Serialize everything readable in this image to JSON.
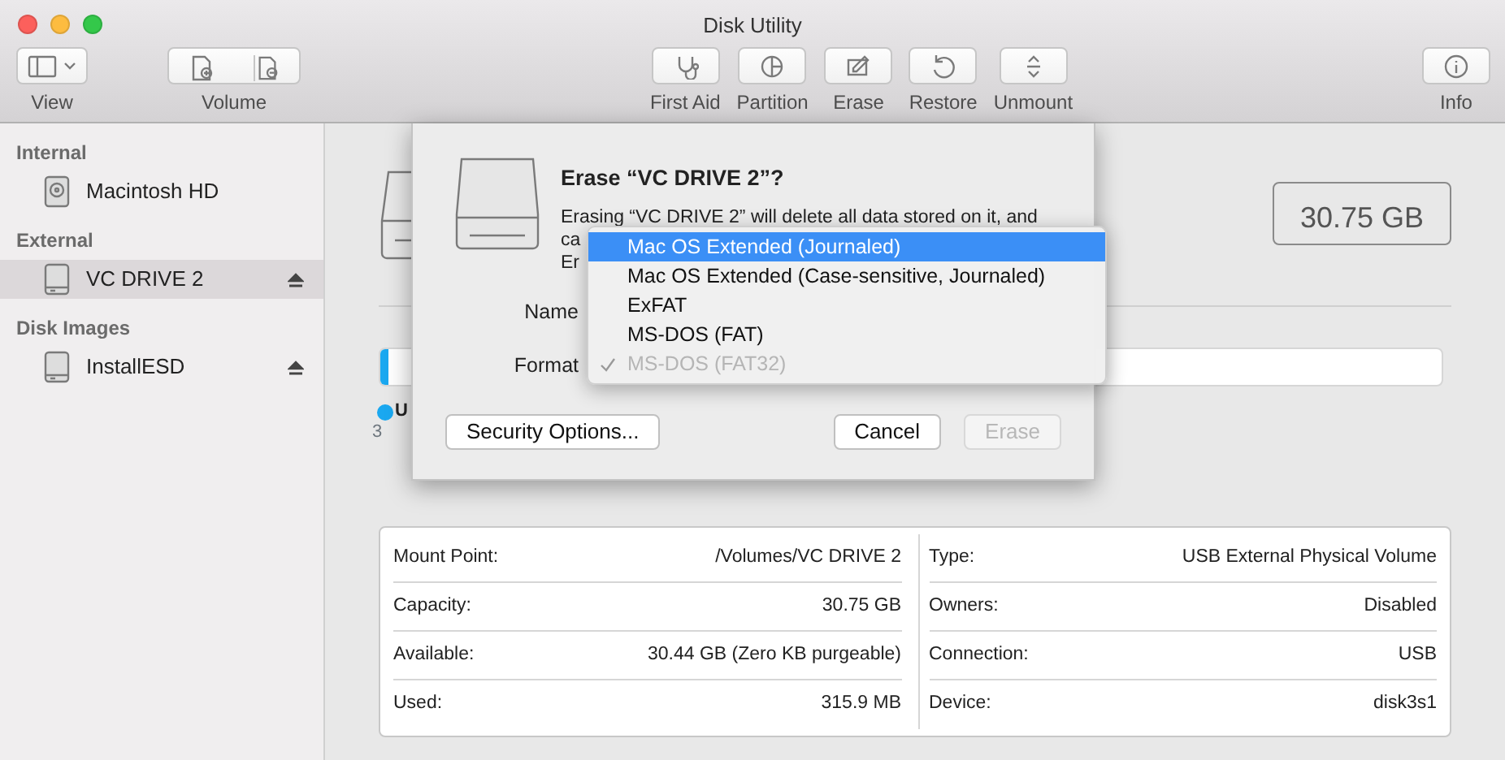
{
  "window": {
    "title": "Disk Utility"
  },
  "toolbar": [
    {
      "label": "View",
      "kind": "view"
    },
    {
      "label": "Volume",
      "kind": "volume"
    },
    {
      "label": "First Aid",
      "kind": "firstaid"
    },
    {
      "label": "Partition",
      "kind": "partition"
    },
    {
      "label": "Erase",
      "kind": "erase"
    },
    {
      "label": "Restore",
      "kind": "restore"
    },
    {
      "label": "Unmount",
      "kind": "unmount"
    },
    {
      "label": "Info",
      "kind": "info"
    }
  ],
  "sidebar": [
    {
      "title": "Internal",
      "items": [
        {
          "name": "Macintosh HD",
          "kind": "internal",
          "selected": false,
          "ejectable": false
        }
      ]
    },
    {
      "title": "External",
      "items": [
        {
          "name": "VC DRIVE 2",
          "kind": "external",
          "selected": true,
          "ejectable": true
        }
      ]
    },
    {
      "title": "Disk Images",
      "items": [
        {
          "name": "InstallESD",
          "kind": "external",
          "selected": false,
          "ejectable": true
        }
      ]
    }
  ],
  "main": {
    "size": "30.75 GB",
    "usage": {
      "level": 0.008,
      "legend_label": "U",
      "legend_value": "3"
    },
    "info_left": [
      {
        "label": "Mount Point:",
        "value": "/Volumes/VC DRIVE 2"
      },
      {
        "label": "Capacity:",
        "value": "30.75 GB"
      },
      {
        "label": "Available:",
        "value": "30.44 GB (Zero KB purgeable)"
      },
      {
        "label": "Used:",
        "value": "315.9 MB"
      }
    ],
    "info_right": [
      {
        "label": "Type:",
        "value": "USB External Physical Volume"
      },
      {
        "label": "Owners:",
        "value": "Disabled"
      },
      {
        "label": "Connection:",
        "value": "USB"
      },
      {
        "label": "Device:",
        "value": "disk3s1"
      }
    ]
  },
  "dialog": {
    "title": "Erase “VC DRIVE 2”?",
    "message_lines": [
      "Erasing “VC DRIVE 2” will delete all data stored on it, and",
      "ca",
      "Er"
    ],
    "name_label": "Name",
    "format_label": "Format",
    "format_menu": [
      {
        "label": "Mac OS Extended (Journaled)",
        "selected": true,
        "checked": false,
        "disabled": false
      },
      {
        "label": "Mac OS Extended (Case-sensitive, Journaled)",
        "selected": false,
        "checked": false,
        "disabled": false
      },
      {
        "label": "ExFAT",
        "selected": false,
        "checked": false,
        "disabled": false
      },
      {
        "label": "MS-DOS (FAT)",
        "selected": false,
        "checked": false,
        "disabled": false
      },
      {
        "label": "MS-DOS (FAT32)",
        "selected": false,
        "checked": true,
        "disabled": true
      }
    ],
    "buttons": [
      {
        "label": "Security Options...",
        "kind": "left",
        "disabled": false
      },
      {
        "label": "Cancel",
        "kind": "right",
        "disabled": false
      },
      {
        "label": "Erase",
        "kind": "right",
        "disabled": true
      }
    ]
  }
}
